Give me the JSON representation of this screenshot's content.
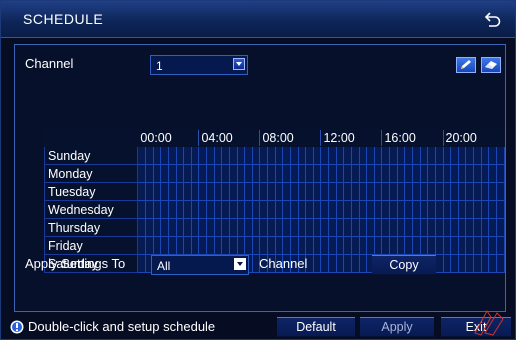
{
  "window": {
    "title": "SCHEDULE"
  },
  "channel": {
    "label": "Channel",
    "value": "1"
  },
  "grid": {
    "times": [
      "00:00",
      "04:00",
      "08:00",
      "12:00",
      "16:00",
      "20:00"
    ],
    "days": [
      "Sunday",
      "Monday",
      "Tuesday",
      "Wednesday",
      "Thursday",
      "Friday",
      "Saturday"
    ]
  },
  "apply": {
    "label": "Apply Settings To",
    "value": "All",
    "channel_label": "Channel",
    "copy_label": "Copy"
  },
  "footer": {
    "hint": "Double-click and setup schedule",
    "default_label": "Default",
    "apply_label": "Apply",
    "exit_label": "Exit"
  },
  "colors": {
    "grid_cell": "#061b54",
    "grid_line": "#1c46b4",
    "title_bar": "#0d2456",
    "accent": "#2f5fc0"
  },
  "icons": {
    "back": "back-arrow-icon",
    "edit": "pencil-icon",
    "erase": "eraser-icon",
    "info": "info-icon",
    "dropdown": "chevron-down-icon"
  }
}
